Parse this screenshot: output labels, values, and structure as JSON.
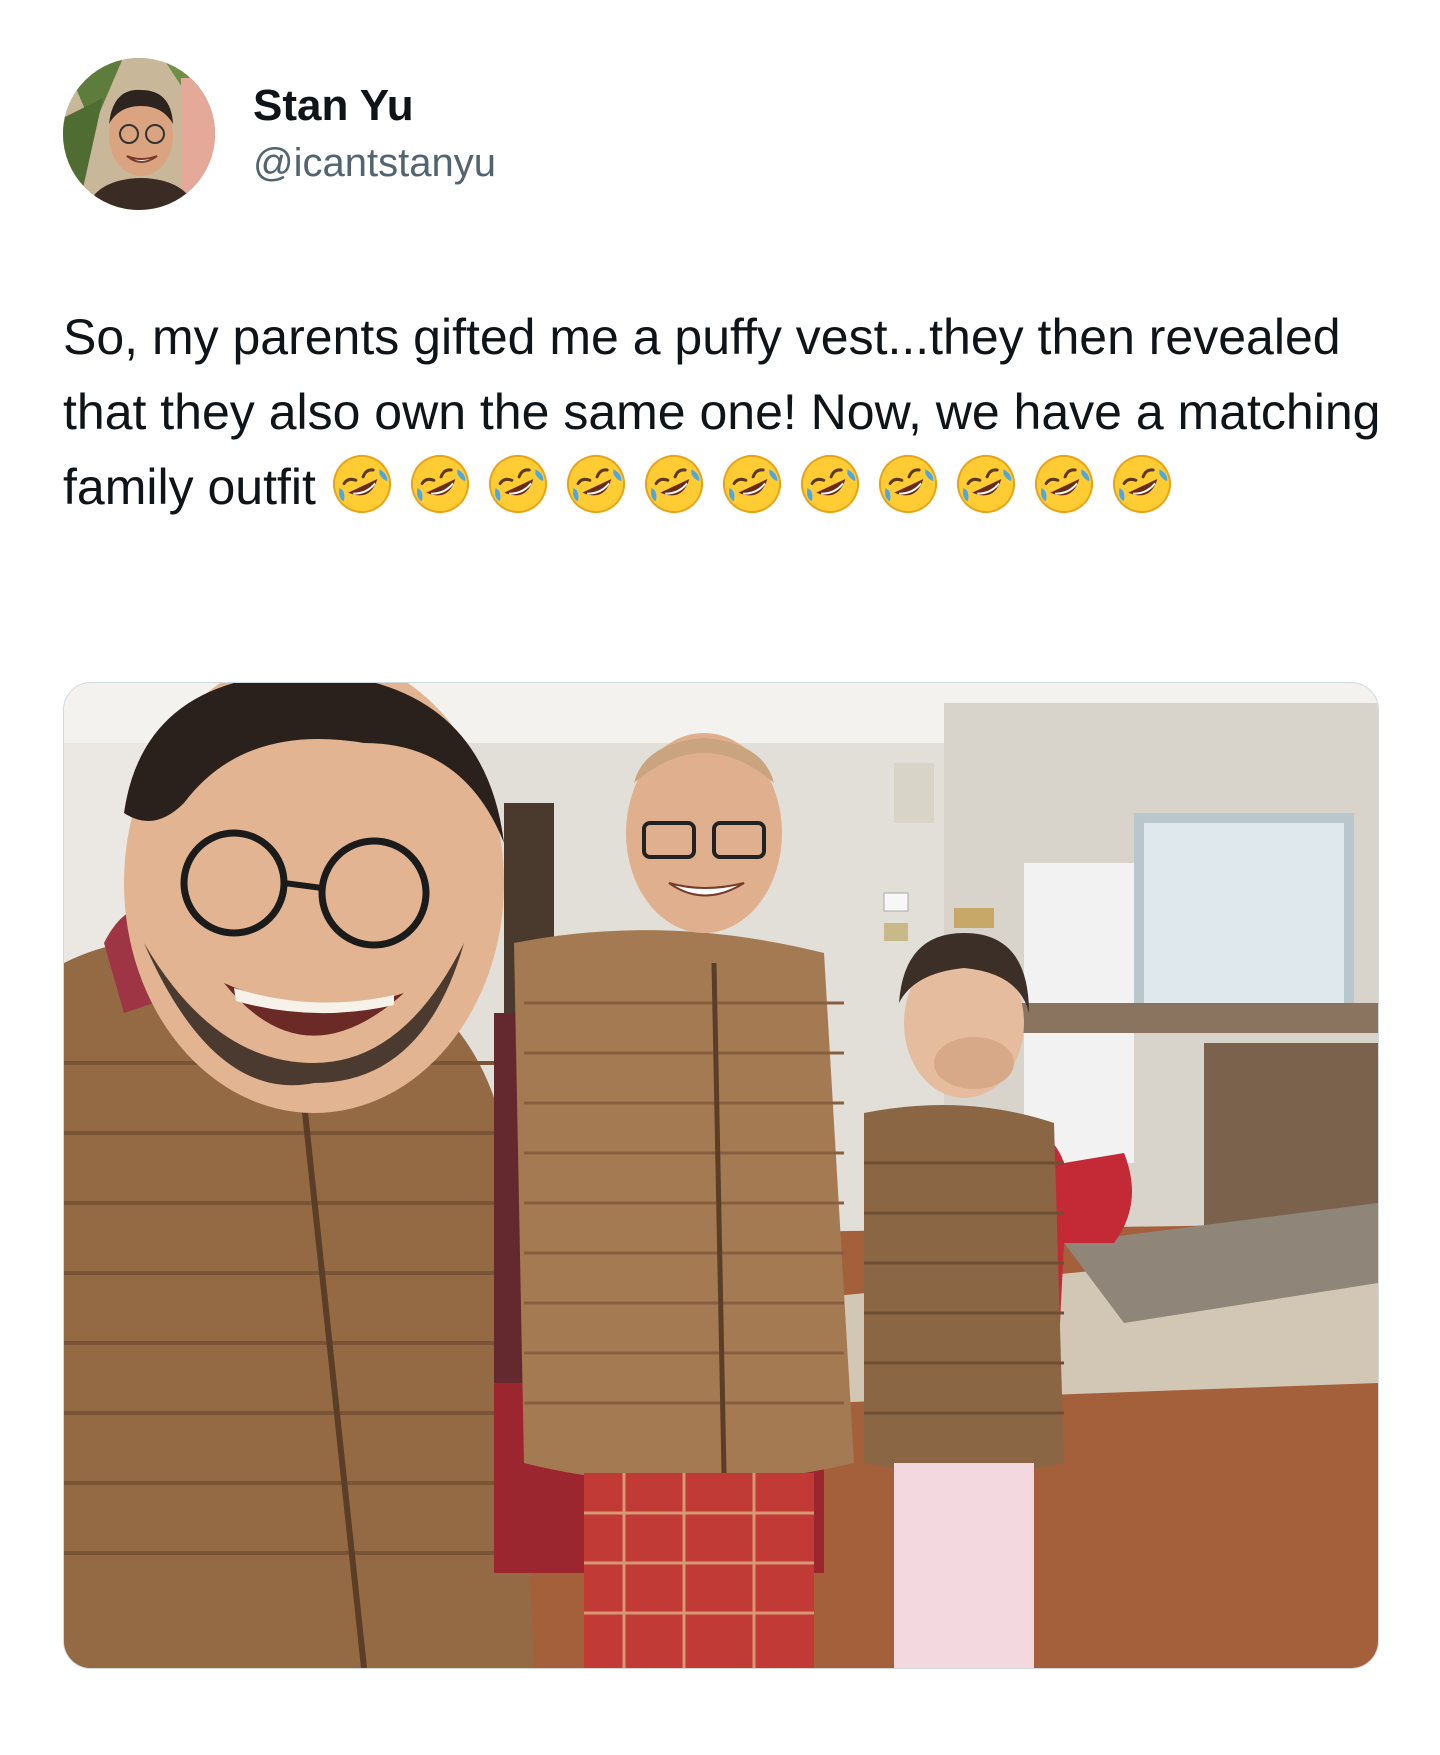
{
  "tweet": {
    "author": {
      "display_name": "Stan Yu",
      "handle": "@icantstanyu",
      "avatar_icon": "profile-photo"
    },
    "text": "So, my parents gifted me a puffy vest...they then revealed that they also own the same one! Now, we have a matching family outfit",
    "emoji": {
      "name": "rolling-on-the-floor-laughing-emoji",
      "count": 11
    },
    "media": {
      "type": "photo",
      "description_icon": "family-photo-matching-vests"
    }
  },
  "colors": {
    "text_primary": "#0f1419",
    "text_secondary": "#536471",
    "border": "#cfd9de",
    "vest_brown": "#9a6f47"
  }
}
